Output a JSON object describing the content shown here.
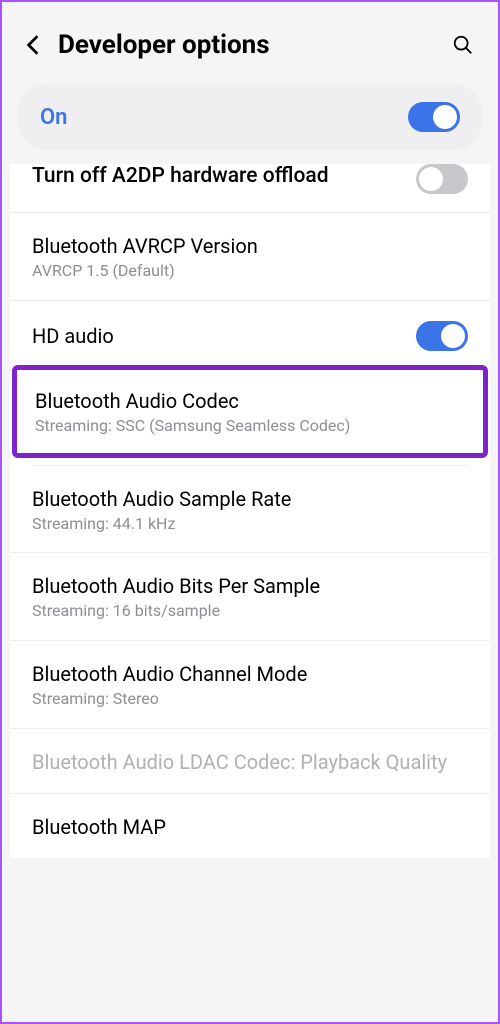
{
  "header": {
    "title": "Developer options"
  },
  "master": {
    "label": "On",
    "enabled": true
  },
  "rows": {
    "a2dp": {
      "title": "Turn off A2DP hardware offload"
    },
    "avrcp": {
      "title": "Bluetooth AVRCP Version",
      "sub": "AVRCP 1.5 (Default)"
    },
    "hd": {
      "title": "HD audio"
    },
    "codec": {
      "title": "Bluetooth Audio Codec",
      "sub": "Streaming: SSC (Samsung Seamless Codec)"
    },
    "sample_rate": {
      "title": "Bluetooth Audio Sample Rate",
      "sub": "Streaming: 44.1 kHz"
    },
    "bits": {
      "title": "Bluetooth Audio Bits Per Sample",
      "sub": "Streaming: 16 bits/sample"
    },
    "channel": {
      "title": "Bluetooth Audio Channel Mode",
      "sub": "Streaming: Stereo"
    },
    "ldac": {
      "title": "Bluetooth Audio LDAC Codec: Playback Quality"
    },
    "map": {
      "title": "Bluetooth MAP"
    }
  }
}
